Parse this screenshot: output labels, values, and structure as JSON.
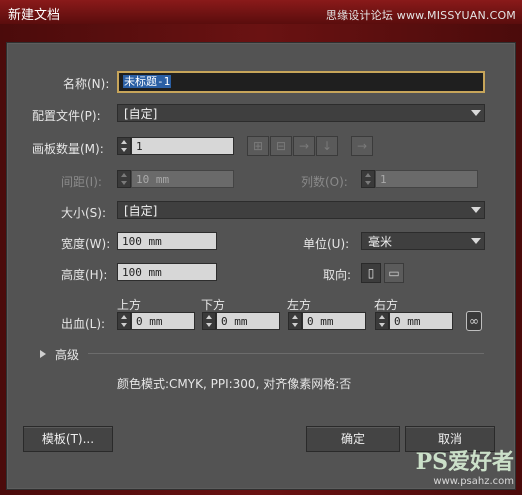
{
  "window": {
    "title": "新建文档",
    "site_top": "思缘设计论坛 www.MISSYUAN.COM"
  },
  "dialog": {
    "name_label": "名称(N):",
    "name_value": "未标题-1",
    "profile_label": "配置文件(P):",
    "profile_value": "[自定]",
    "artboards_label": "画板数量(M):",
    "artboards_value": "1",
    "artboard_layout_icons": [
      "grid-by-row-icon",
      "grid-by-column-icon",
      "arrange-by-row-icon",
      "arrange-by-column-icon",
      "right-to-left-icon"
    ],
    "spacing_label": "间距(I):",
    "spacing_value": "10 mm",
    "columns_label": "列数(O):",
    "columns_value": "1",
    "size_label": "大小(S):",
    "size_value": "[自定]",
    "width_label": "宽度(W):",
    "width_value": "100 mm",
    "unit_label": "单位(U):",
    "unit_value": "毫米",
    "height_label": "高度(H):",
    "height_value": "100 mm",
    "orientation_label": "取向:",
    "orientation_icons": [
      "portrait-icon",
      "landscape-icon"
    ],
    "bleed_label": "出血(L):",
    "bleed": {
      "top_label": "上方",
      "top_value": "0 mm",
      "bottom_label": "下方",
      "bottom_value": "0 mm",
      "left_label": "左方",
      "left_value": "0 mm",
      "right_label": "右方",
      "right_value": "0 mm"
    },
    "advanced_label": "高级",
    "summary": "颜色模式:CMYK, PPI:300, 对齐像素网格:否",
    "template_button": "模板(T)...",
    "ok_button": "确定",
    "cancel_button": "取消"
  },
  "watermark": {
    "logo": "PS爱好者",
    "url": "www.psahz.com"
  }
}
